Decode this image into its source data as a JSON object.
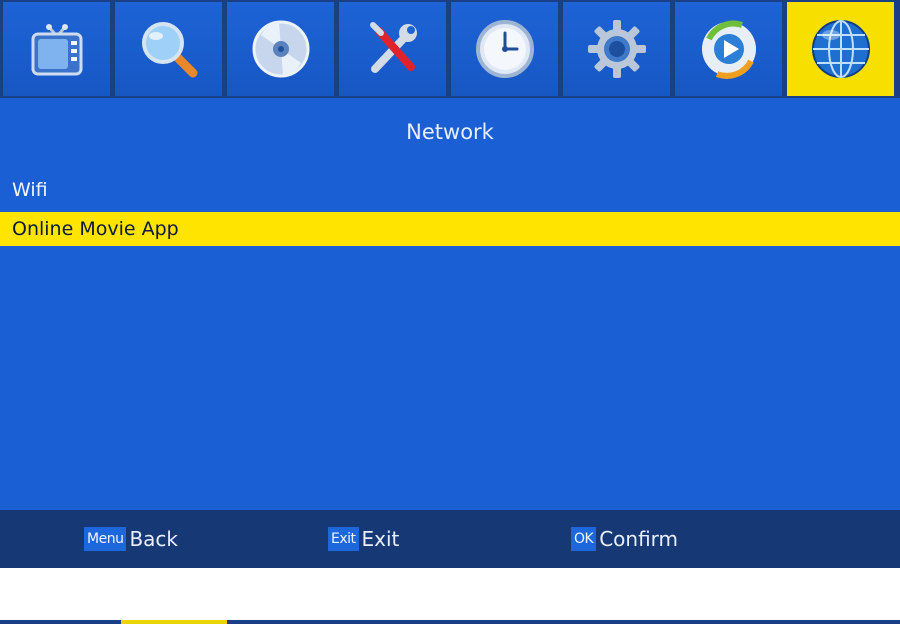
{
  "screen": {
    "title": "Network",
    "tabs": [
      {
        "icon": "tv-icon",
        "selected": false
      },
      {
        "icon": "search-icon",
        "selected": false
      },
      {
        "icon": "disc-icon",
        "selected": false
      },
      {
        "icon": "tools-icon",
        "selected": false
      },
      {
        "icon": "clock-icon",
        "selected": false
      },
      {
        "icon": "gear-icon",
        "selected": false
      },
      {
        "icon": "media-play-icon",
        "selected": false
      },
      {
        "icon": "globe-icon",
        "selected": true
      }
    ],
    "menu": [
      {
        "label": "Wifi",
        "selected": false
      },
      {
        "label": "Online Movie App",
        "selected": true
      }
    ]
  },
  "footer": {
    "back": {
      "key": "Menu",
      "label": "Back"
    },
    "exit": {
      "key": "Exit",
      "label": "Exit"
    },
    "confirm": {
      "key": "OK",
      "label": "Confirm"
    }
  },
  "colors": {
    "background": "#1a5fd3",
    "highlight": "#ffe400",
    "footer": "#163976"
  }
}
